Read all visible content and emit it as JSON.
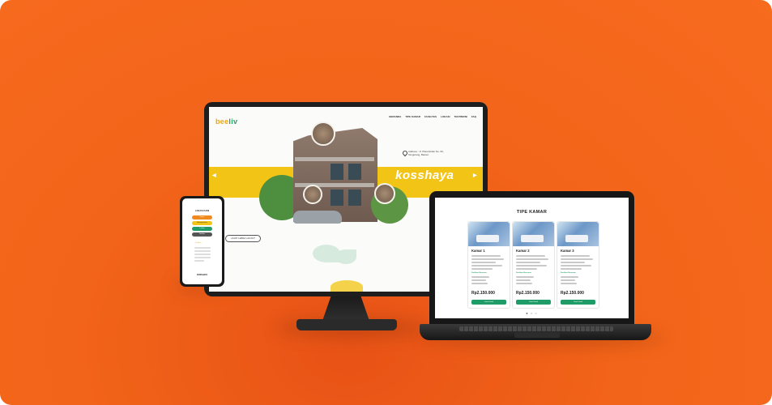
{
  "colors": {
    "background": "#f26419",
    "accent_yellow": "#f2c416",
    "accent_green": "#1f9c68",
    "logo_orange": "#e8a71a"
  },
  "monitor": {
    "logo_part1": "bee",
    "logo_part2": "liv",
    "nav_links": [
      "BERANDA",
      "TIPE KAMAR",
      "FASILITAS",
      "LOKASI",
      "TESTIMONI",
      "FAQ"
    ],
    "hero_title": "kosshaya",
    "address": "Address : Jl. Placeholder No. 00, Tangerang, Banten",
    "cta_label": "LIHAT LEBIH LANJUT",
    "arrow_left": "◀",
    "arrow_right": "▶"
  },
  "phone": {
    "title": "LOKASI KAMI",
    "buttons": [
      {
        "label": "Kamar",
        "color": "#f08a1e"
      },
      {
        "label": "Hubungi Kami",
        "color": "#f2c416"
      },
      {
        "label": "Lokasi",
        "color": "#1f9c68"
      },
      {
        "label": "Fasilitas",
        "color": "#555555"
      }
    ],
    "section_label": "Fasilitas",
    "footer": "KOSSHAYA"
  },
  "laptop": {
    "title": "TIPE KAMAR",
    "cards": [
      {
        "name": "Kamar 1",
        "subheading": "Fasilitas Bersama",
        "price": "Rp2.150.000",
        "button": "Lihat Detail"
      },
      {
        "name": "Kamar 2",
        "subheading": "Fasilitas Bersama",
        "price": "Rp2.150.000",
        "button": "Lihat Detail"
      },
      {
        "name": "Kamar 3",
        "subheading": "Fasilitas Bersama",
        "price": "Rp2.150.000",
        "button": "Lihat Detail"
      }
    ],
    "pagination": "● ○ ○"
  }
}
